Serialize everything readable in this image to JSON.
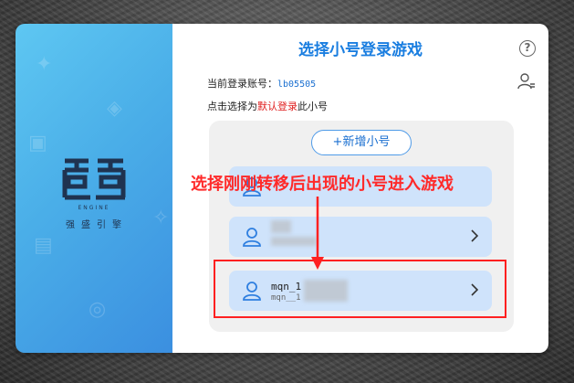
{
  "brand": {
    "logo_text": "强盛引擎",
    "engine_label": "ENGINE"
  },
  "dialog": {
    "title": "选择小号登录游戏",
    "current_account_label": "当前登录账号：",
    "current_account_value": "lb05505",
    "hint_prefix": "点击选择为",
    "hint_emphasis": "默认登录",
    "hint_suffix": "此小号",
    "add_button_label": "+新增小号"
  },
  "accounts": [
    {
      "name": "",
      "sub": ""
    },
    {
      "name": "",
      "sub": ""
    },
    {
      "name": "mqn_1",
      "sub": "mqn__1"
    }
  ],
  "annotation": {
    "text": "选择刚刚转移后出现的小号进入游戏"
  },
  "colors": {
    "accent": "#1a7ee0",
    "emphasis": "#e02020",
    "item_bg": "#cfe3fb"
  }
}
